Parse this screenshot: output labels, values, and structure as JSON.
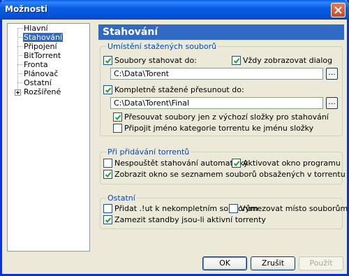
{
  "window": {
    "title": "Možnosti"
  },
  "tree": {
    "items": [
      {
        "label": "Hlavní"
      },
      {
        "label": "Stahování",
        "selected": true
      },
      {
        "label": "Připojení"
      },
      {
        "label": "BitTorrent"
      },
      {
        "label": "Fronta"
      },
      {
        "label": "Plánovač"
      },
      {
        "label": "Ostatní"
      },
      {
        "label": "Rozšířené",
        "expandable": true
      }
    ]
  },
  "page": {
    "title": "Stahování"
  },
  "location_group": {
    "title": "Umístění stažených souborů",
    "download_to": {
      "label": "Soubory stahovat do:",
      "checked": true
    },
    "always_show_dialog": {
      "label": "Vždy zobrazovat dialog",
      "checked": true
    },
    "download_path": "C:\\Data\\Torent",
    "move_completed": {
      "label": "Kompletně stažené přesunout do:",
      "checked": true
    },
    "completed_path": "C:\\Data\\Torent\\Final",
    "move_only_from_default": {
      "label": "Přesouvat soubory jen z výchozí složky pro stahování",
      "checked": true
    },
    "append_label": {
      "label": "Připojit jméno kategorie torrentu ke jménu složky",
      "checked": false
    },
    "browse_label": "..."
  },
  "adding_group": {
    "title": "Při přidávání torrentů",
    "dont_start": {
      "label": "Nespouštět stahování automaticky",
      "checked": false
    },
    "activate_window": {
      "label": "Aktivovat okno programu",
      "checked": true
    },
    "show_files_dialog": {
      "label": "Zobrazit okno se seznamem souborů obsažených v torrentu",
      "checked": true
    }
  },
  "other_group": {
    "title": "Ostatní",
    "append_ut": {
      "label": "Přidat .!ut k nekompletním souborům",
      "checked": false
    },
    "prealloc": {
      "label": "Vymezovat místo souborům",
      "checked": false
    },
    "prevent_standby": {
      "label": "Zamezit standby jsou-li aktivní torrenty",
      "checked": true
    }
  },
  "buttons": {
    "ok": "OK",
    "cancel": "Zrušit",
    "apply": "Použít"
  },
  "colors": {
    "accent": "#316ac5",
    "group_title": "#0046d5",
    "titlebar": "#0a5ee3"
  }
}
